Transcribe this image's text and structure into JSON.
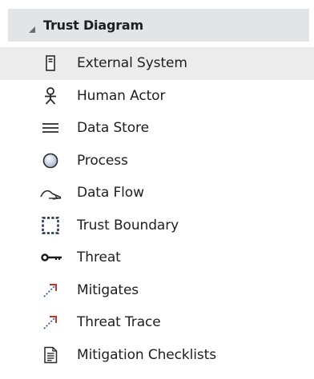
{
  "toolbox": {
    "section_title": "Trust Diagram",
    "items": [
      {
        "label": "External System",
        "icon": "external-system-icon",
        "selected": true
      },
      {
        "label": "Human Actor",
        "icon": "human-actor-icon",
        "selected": false
      },
      {
        "label": "Data Store",
        "icon": "data-store-icon",
        "selected": false
      },
      {
        "label": "Process",
        "icon": "process-icon",
        "selected": false
      },
      {
        "label": "Data Flow",
        "icon": "data-flow-icon",
        "selected": false
      },
      {
        "label": "Trust Boundary",
        "icon": "trust-boundary-icon",
        "selected": false
      },
      {
        "label": "Threat",
        "icon": "threat-icon",
        "selected": false
      },
      {
        "label": "Mitigates",
        "icon": "mitigates-icon",
        "selected": false
      },
      {
        "label": "Threat Trace",
        "icon": "threat-trace-icon",
        "selected": false
      },
      {
        "label": "Mitigation Checklists",
        "icon": "mitigation-checklists-icon",
        "selected": false
      }
    ]
  }
}
